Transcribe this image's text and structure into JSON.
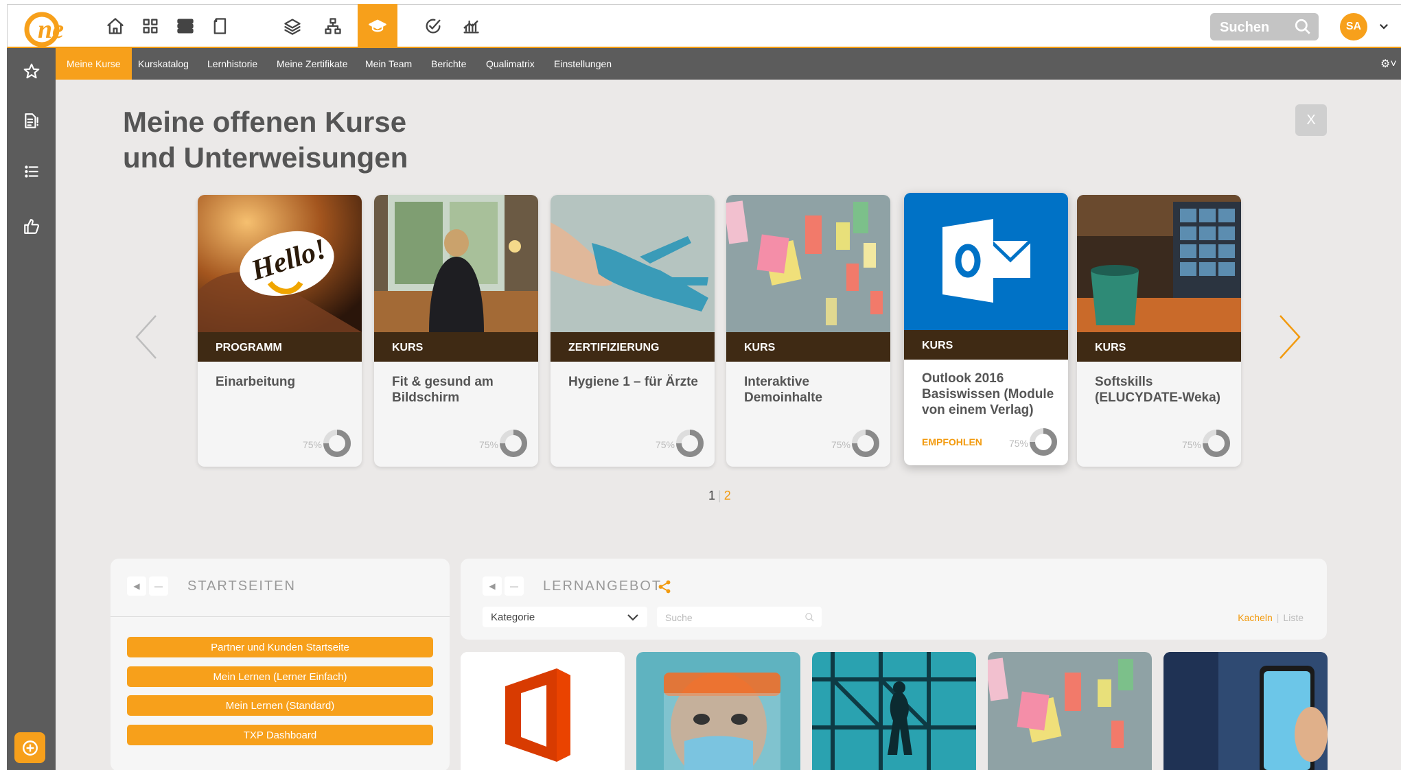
{
  "topbar": {
    "logo_text": "ne",
    "search_placeholder": "Suchen",
    "user_initials": "SA",
    "icons": [
      "home-icon",
      "dashboard-icon",
      "layers-stack-icon",
      "book-icon",
      "layers-icon",
      "org-chart-icon",
      "graduation-cap-icon",
      "target-check-icon",
      "chart-icon"
    ]
  },
  "subnav": {
    "tabs": [
      {
        "label": "Meine Kurse",
        "active": true
      },
      {
        "label": "Kurskatalog"
      },
      {
        "label": "Lernhistorie"
      },
      {
        "label": "Meine Zertifikate"
      },
      {
        "label": "Mein Team"
      },
      {
        "label": "Berichte"
      },
      {
        "label": "Qualimatrix"
      },
      {
        "label": "Einstellungen"
      }
    ]
  },
  "main": {
    "heading_line1": "Meine offenen Kurse",
    "heading_line2": "und Unterweisungen",
    "close_label": "X"
  },
  "courses": [
    {
      "type": "PROGRAMM",
      "title": "Einarbeitung",
      "progress": "75%"
    },
    {
      "type": "KURS",
      "title": "Fit & gesund am Bildschirm",
      "progress": "75%"
    },
    {
      "type": "ZERTIFIZIERUNG",
      "title": "Hygiene 1 – für Ärzte",
      "progress": "75%"
    },
    {
      "type": "KURS",
      "title": "Interaktive Demoinhalte",
      "progress": "75%"
    },
    {
      "type": "KURS",
      "title": "Outlook 2016 Basiswissen (Module von einem Verlag)",
      "progress": "75%",
      "badge": "EMPFOHLEN"
    },
    {
      "type": "KURS",
      "title": "Softskills (ELUCYDATE-Weka)",
      "progress": "75%"
    }
  ],
  "pager": {
    "page1": "1",
    "sep": "|",
    "page2": "2"
  },
  "startseiten": {
    "title": "STARTSEITEN",
    "buttons": [
      "Partner und Kunden Startseite",
      "Mein Lernen (Lerner Einfach)",
      "Mein Lernen (Standard)",
      "TXP Dashboard"
    ]
  },
  "lernangebot": {
    "title": "LERNANGEBOT",
    "category_select": "Kategorie",
    "search_placeholder": "Suche",
    "view_tiles": "Kacheln",
    "view_sep": "|",
    "view_list": "Liste"
  },
  "colors": {
    "accent": "#f7a01b",
    "nav_bg": "#5c5c5c",
    "card_type_bg": "#3f2a14",
    "outlook_blue": "#0072c6"
  }
}
